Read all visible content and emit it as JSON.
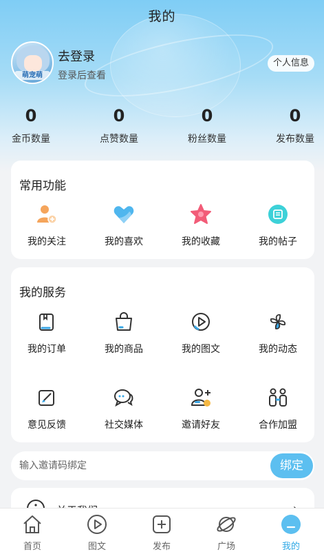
{
  "header": {
    "title": "我的"
  },
  "user": {
    "name": "去登录",
    "subtitle": "登录后查看",
    "avatar_tag": "萌宠萌",
    "profile_button": "个人信息"
  },
  "stats": [
    {
      "value": "0",
      "label": "金币数量"
    },
    {
      "value": "0",
      "label": "点赞数量"
    },
    {
      "value": "0",
      "label": "粉丝数量"
    },
    {
      "value": "0",
      "label": "发布数量"
    }
  ],
  "common": {
    "title": "常用功能",
    "items": [
      {
        "label": "我的关注",
        "icon": "follow-icon"
      },
      {
        "label": "我的喜欢",
        "icon": "heart-icon"
      },
      {
        "label": "我的收藏",
        "icon": "star-icon"
      },
      {
        "label": "我的帖子",
        "icon": "post-icon"
      }
    ]
  },
  "services": {
    "title": "我的服务",
    "items": [
      {
        "label": "我的订单",
        "icon": "order-icon"
      },
      {
        "label": "我的商品",
        "icon": "shopping-bag-icon"
      },
      {
        "label": "我的图文",
        "icon": "play-icon"
      },
      {
        "label": "我的动态",
        "icon": "pinwheel-icon"
      },
      {
        "label": "意见反馈",
        "icon": "edit-icon"
      },
      {
        "label": "社交媒体",
        "icon": "chat-icon"
      },
      {
        "label": "邀请好友",
        "icon": "add-user-icon"
      },
      {
        "label": "合作加盟",
        "icon": "partners-icon"
      }
    ]
  },
  "invite": {
    "placeholder": "输入邀请码绑定",
    "button": "绑定"
  },
  "about": {
    "label": "关于我们"
  },
  "tabs": [
    {
      "label": "首页",
      "icon": "home-icon"
    },
    {
      "label": "图文",
      "icon": "play-icon"
    },
    {
      "label": "发布",
      "icon": "plus-icon"
    },
    {
      "label": "广场",
      "icon": "planet-icon"
    },
    {
      "label": "我的",
      "icon": "user-icon",
      "active": true
    }
  ],
  "colors": {
    "accent": "#2fa8e6",
    "bind_button": "#5cbff0",
    "hero_top": "#7fcdf5"
  }
}
